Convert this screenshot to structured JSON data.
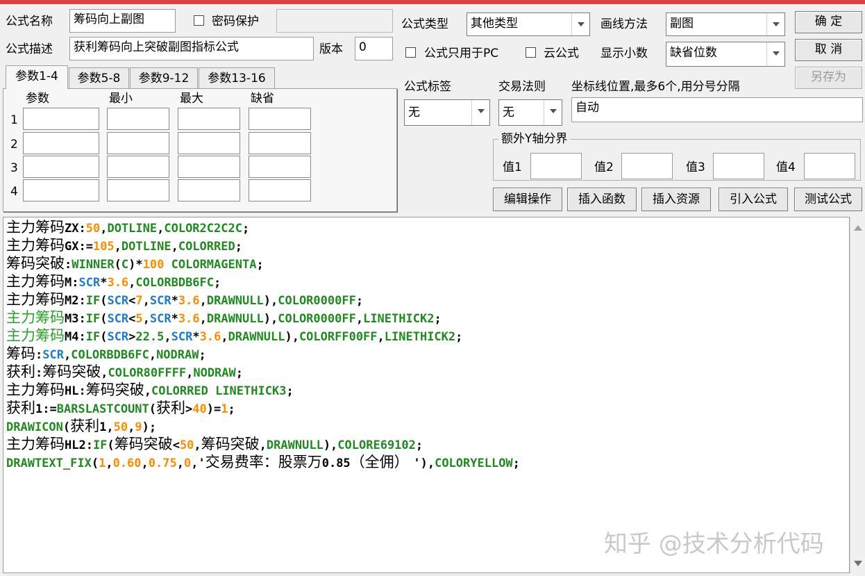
{
  "top": {
    "formula_name_label": "公式名称",
    "formula_name_value": "筹码向上副图",
    "password_label": "密码保护",
    "password_value": "",
    "formula_desc_label": "公式描述",
    "formula_desc_value": "获利筹码向上突破副图指标公式",
    "version_label": "版本",
    "version_value": "0",
    "formula_type_label": "公式类型",
    "formula_type_value": "其他类型",
    "draw_method_label": "画线方法",
    "draw_method_value": "副图",
    "pc_only_label": "公式只用于PC",
    "cloud_label": "云公式",
    "decimals_label": "显示小数",
    "decimals_value": "缺省位数"
  },
  "buttons": {
    "ok": "确 定",
    "cancel": "取 消",
    "save_as": "另存为",
    "edit_ops": "编辑操作",
    "insert_func": "插入函数",
    "insert_res": "插入资源",
    "import_formula": "引入公式",
    "test_formula": "测试公式"
  },
  "tabs": [
    "参数1-4",
    "参数5-8",
    "参数9-12",
    "参数13-16"
  ],
  "param_headers": [
    "参数",
    "最小",
    "最大",
    "缺省"
  ],
  "param_rows": [
    "1",
    "2",
    "3",
    "4"
  ],
  "right": {
    "tag_label": "公式标签",
    "tag_value": "无",
    "rule_label": "交易法则",
    "rule_value": "无",
    "axis_label": "坐标线位置,最多6个,用分号分隔",
    "axis_value": "自动",
    "extra_y_label": "额外Y轴分界",
    "v1": "值1",
    "v2": "值2",
    "v3": "值3",
    "v4": "值4"
  },
  "colors": {
    "cn": "#000000",
    "kw": "#1f8a1f",
    "num": "#ff8c00",
    "var": "#1e7bd0",
    "op": "#000000",
    "cn_green": "#27a327"
  },
  "code": [
    [
      [
        "cn",
        "主力筹码"
      ],
      [
        "op",
        "ZX:"
      ],
      [
        "num",
        "50"
      ],
      [
        "op",
        ","
      ],
      [
        "kw",
        "DOTLINE"
      ],
      [
        "op",
        ","
      ],
      [
        "kw",
        "COLOR2C2C2C"
      ],
      [
        "op",
        ";"
      ]
    ],
    [
      [
        "cn",
        "主力筹码"
      ],
      [
        "op",
        "GX:="
      ],
      [
        "num",
        "105"
      ],
      [
        "op",
        ","
      ],
      [
        "kw",
        "DOTLINE"
      ],
      [
        "op",
        ","
      ],
      [
        "kw",
        "COLORRED"
      ],
      [
        "op",
        ";"
      ]
    ],
    [
      [
        "cn",
        "筹码突破"
      ],
      [
        "op",
        ":"
      ],
      [
        "kw",
        "WINNER"
      ],
      [
        "op",
        "("
      ],
      [
        "kw",
        "C"
      ],
      [
        "op",
        ")*"
      ],
      [
        "num",
        "100"
      ],
      [
        "op",
        " "
      ],
      [
        "kw",
        "COLORMAGENTA"
      ],
      [
        "op",
        ";"
      ]
    ],
    [
      [
        "cn",
        "主力筹码"
      ],
      [
        "op",
        "M:"
      ],
      [
        "var",
        "SCR"
      ],
      [
        "op",
        "*"
      ],
      [
        "num",
        "3.6"
      ],
      [
        "op",
        ","
      ],
      [
        "kw",
        "COLORBDB6FC"
      ],
      [
        "op",
        ";"
      ]
    ],
    [
      [
        "cn",
        "主力筹码"
      ],
      [
        "op",
        "M2:"
      ],
      [
        "kw",
        "IF"
      ],
      [
        "op",
        "("
      ],
      [
        "var",
        "SCR"
      ],
      [
        "op",
        "<"
      ],
      [
        "num",
        "7"
      ],
      [
        "op",
        ","
      ],
      [
        "var",
        "SCR"
      ],
      [
        "op",
        "*"
      ],
      [
        "num",
        "3.6"
      ],
      [
        "op",
        ","
      ],
      [
        "kw",
        "DRAWNULL"
      ],
      [
        "op",
        "),"
      ],
      [
        "kw",
        "COLOR0000FF"
      ],
      [
        "op",
        ";"
      ]
    ],
    [
      [
        "cn_green",
        "主力筹码"
      ],
      [
        "op",
        "M3:"
      ],
      [
        "kw",
        "IF"
      ],
      [
        "op",
        "("
      ],
      [
        "var",
        "SCR"
      ],
      [
        "op",
        "<"
      ],
      [
        "num",
        "5"
      ],
      [
        "op",
        ","
      ],
      [
        "var",
        "SCR"
      ],
      [
        "op",
        "*"
      ],
      [
        "num",
        "3.6"
      ],
      [
        "op",
        ","
      ],
      [
        "kw",
        "DRAWNULL"
      ],
      [
        "op",
        "),"
      ],
      [
        "kw",
        "COLOR0000FF"
      ],
      [
        "op",
        ","
      ],
      [
        "kw",
        "LINETHICK2"
      ],
      [
        "op",
        ";"
      ]
    ],
    [
      [
        "cn_green",
        "主力筹码"
      ],
      [
        "op",
        "M4:"
      ],
      [
        "kw",
        "IF"
      ],
      [
        "op",
        "("
      ],
      [
        "var",
        "SCR"
      ],
      [
        "op",
        ">"
      ],
      [
        "kw",
        "22.5"
      ],
      [
        "op",
        ","
      ],
      [
        "var",
        "SCR"
      ],
      [
        "op",
        "*"
      ],
      [
        "num",
        "3.6"
      ],
      [
        "op",
        ","
      ],
      [
        "kw",
        "DRAWNULL"
      ],
      [
        "op",
        "),"
      ],
      [
        "kw",
        "COLORFF00FF"
      ],
      [
        "op",
        ","
      ],
      [
        "kw",
        "LINETHICK2"
      ],
      [
        "op",
        ";"
      ]
    ],
    [
      [
        "cn",
        "筹码"
      ],
      [
        "op",
        ":"
      ],
      [
        "var",
        "SCR"
      ],
      [
        "op",
        ","
      ],
      [
        "kw",
        "COLORBDB6FC"
      ],
      [
        "op",
        ","
      ],
      [
        "kw",
        "NODRAW"
      ],
      [
        "op",
        ";"
      ]
    ],
    [
      [
        "cn",
        "获利"
      ],
      [
        "op",
        ":"
      ],
      [
        "cn",
        "筹码突破"
      ],
      [
        "op",
        ","
      ],
      [
        "kw",
        "COLOR80FFFF"
      ],
      [
        "op",
        ","
      ],
      [
        "kw",
        "NODRAW"
      ],
      [
        "op",
        ";"
      ]
    ],
    [
      [
        "cn",
        "主力筹码"
      ],
      [
        "op",
        "HL:"
      ],
      [
        "cn",
        "筹码突破"
      ],
      [
        "op",
        ","
      ],
      [
        "kw",
        "COLORRED LINETHICK3"
      ],
      [
        "op",
        ";"
      ]
    ],
    [
      [
        "cn",
        "获利"
      ],
      [
        "op",
        "1:="
      ],
      [
        "kw",
        "BARSLASTCOUNT"
      ],
      [
        "op",
        "("
      ],
      [
        "cn",
        "获利"
      ],
      [
        "op",
        ">"
      ],
      [
        "num",
        "40"
      ],
      [
        "op",
        ")="
      ],
      [
        "num",
        "1"
      ],
      [
        "op",
        ";"
      ]
    ],
    [
      [
        "kw",
        "DRAWICON"
      ],
      [
        "op",
        "("
      ],
      [
        "cn",
        "获利"
      ],
      [
        "op",
        "1,"
      ],
      [
        "num",
        "50"
      ],
      [
        "op",
        ","
      ],
      [
        "num",
        "9"
      ],
      [
        "op",
        ");"
      ]
    ],
    [
      [
        "cn",
        "主力筹码"
      ],
      [
        "op",
        "HL2:"
      ],
      [
        "kw",
        "IF"
      ],
      [
        "op",
        "("
      ],
      [
        "cn",
        "筹码突破"
      ],
      [
        "op",
        "<"
      ],
      [
        "num",
        "50"
      ],
      [
        "op",
        ","
      ],
      [
        "cn",
        "筹码突破"
      ],
      [
        "op",
        ","
      ],
      [
        "kw",
        "DRAWNULL"
      ],
      [
        "op",
        "),"
      ],
      [
        "kw",
        "COLORE69102"
      ],
      [
        "op",
        ";"
      ]
    ],
    [
      [
        "kw",
        "DRAWTEXT_FIX"
      ],
      [
        "op",
        "("
      ],
      [
        "num",
        "1"
      ],
      [
        "op",
        ","
      ],
      [
        "num",
        "0.60"
      ],
      [
        "op",
        ","
      ],
      [
        "num",
        "0.75"
      ],
      [
        "op",
        ","
      ],
      [
        "num",
        "0"
      ],
      [
        "op",
        ",'"
      ],
      [
        "cn",
        "交易费率：股票万"
      ],
      [
        "op",
        "0.85"
      ],
      [
        "cn",
        "（全佣） "
      ],
      [
        "op",
        "'),"
      ],
      [
        "kw",
        "COLORYELLOW"
      ],
      [
        "op",
        ";"
      ]
    ]
  ],
  "watermark": "知乎 @技术分析代码"
}
